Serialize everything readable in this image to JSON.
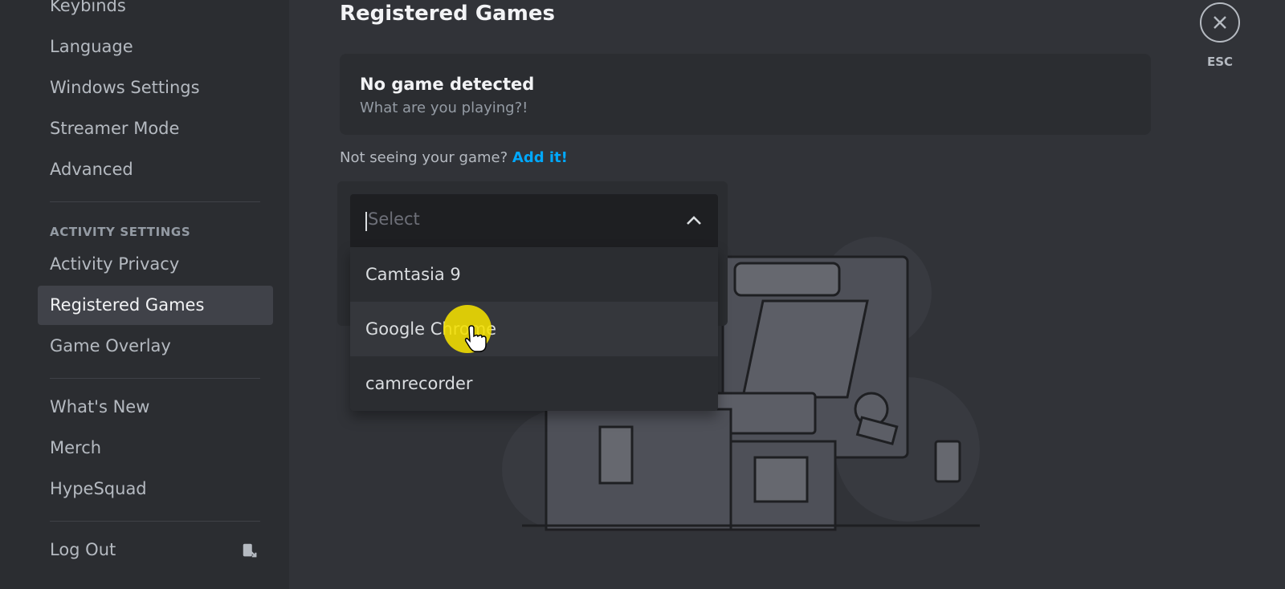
{
  "sidebar": {
    "items_top": [
      {
        "label": "Keybinds"
      },
      {
        "label": "Language"
      },
      {
        "label": "Windows Settings"
      },
      {
        "label": "Streamer Mode"
      },
      {
        "label": "Advanced"
      }
    ],
    "activity_header": "ACTIVITY SETTINGS",
    "activity_items": [
      {
        "label": "Activity Privacy"
      },
      {
        "label": "Registered Games",
        "selected": true
      },
      {
        "label": "Game Overlay"
      }
    ],
    "misc_items": [
      {
        "label": "What's New"
      },
      {
        "label": "Merch"
      },
      {
        "label": "HypeSquad"
      }
    ],
    "logout": {
      "label": "Log Out",
      "icon": "logout-icon"
    }
  },
  "content": {
    "title": "Registered Games",
    "now_playing": {
      "title": "No game detected",
      "subtitle": "What are you playing?!"
    },
    "not_seeing_text": "Not seeing your game?",
    "add_link": "Add it!",
    "dropdown": {
      "placeholder": "Select",
      "options": [
        {
          "label": "Camtasia 9"
        },
        {
          "label": "Google Chrome",
          "hovered": true
        },
        {
          "label": "camrecorder"
        }
      ]
    },
    "esc_label": "ESC"
  },
  "colors": {
    "background": "#313338",
    "sidebar": "#2b2d31",
    "selected_item": "#404249",
    "link": "#00a8fc",
    "cursor_highlight": "#f4e000"
  }
}
